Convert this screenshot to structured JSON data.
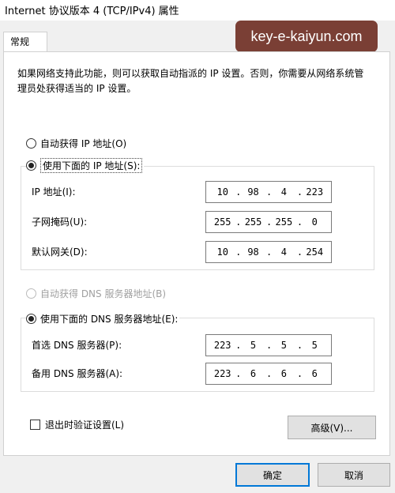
{
  "window": {
    "title": "Internet 协议版本 4 (TCP/IPv4) 属性"
  },
  "watermark": "key-e-kaiyun.com",
  "tab": {
    "label": "常规"
  },
  "description": "如果网络支持此功能，则可以获取自动指派的 IP 设置。否则，你需要从网络系统管理员处获得适当的 IP 设置。",
  "ip_mode": {
    "auto_label": "自动获得 IP 地址(O)",
    "manual_label": "使用下面的 IP 地址(S):",
    "selected": "manual"
  },
  "ip_fields": [
    {
      "label": "IP 地址(I):",
      "octets": [
        "10",
        "98",
        "4",
        "223"
      ]
    },
    {
      "label": "子网掩码(U):",
      "octets": [
        "255",
        "255",
        "255",
        "0"
      ]
    },
    {
      "label": "默认网关(D):",
      "octets": [
        "10",
        "98",
        "4",
        "254"
      ]
    }
  ],
  "dns_mode": {
    "auto_label": "自动获得 DNS 服务器地址(B)",
    "manual_label": "使用下面的 DNS 服务器地址(E):",
    "selected": "manual"
  },
  "dns_fields": [
    {
      "label": "首选 DNS 服务器(P):",
      "octets": [
        "223",
        "5",
        "5",
        "5"
      ]
    },
    {
      "label": "备用 DNS 服务器(A):",
      "octets": [
        "223",
        "6",
        "6",
        "6"
      ]
    }
  ],
  "validate_checkbox": {
    "label": "退出时验证设置(L)",
    "checked": false
  },
  "buttons": {
    "advanced": "高级(V)...",
    "ok": "确定",
    "cancel": "取消"
  }
}
